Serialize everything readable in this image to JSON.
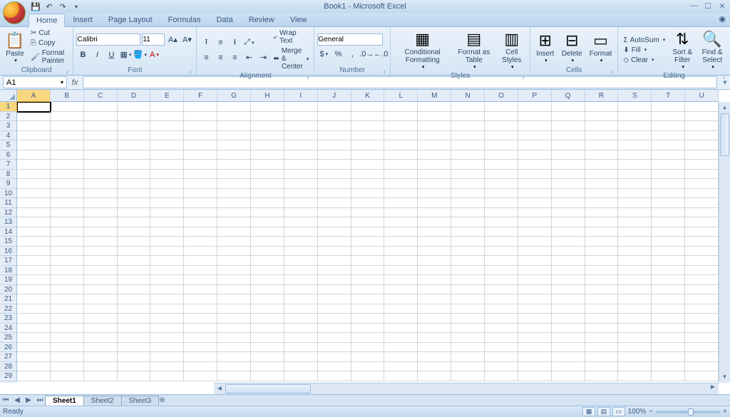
{
  "title": "Book1 - Microsoft Excel",
  "tabs": [
    "Home",
    "Insert",
    "Page Layout",
    "Formulas",
    "Data",
    "Review",
    "View"
  ],
  "active_tab": 0,
  "clipboard": {
    "label": "Clipboard",
    "paste": "Paste",
    "cut": "Cut",
    "copy": "Copy",
    "fmtpainter": "Format Painter"
  },
  "font": {
    "label": "Font",
    "name": "Calibri",
    "size": "11"
  },
  "alignment": {
    "label": "Alignment",
    "wrap": "Wrap Text",
    "merge": "Merge & Center"
  },
  "number": {
    "label": "Number",
    "format": "General"
  },
  "styles": {
    "label": "Styles",
    "cond": "Conditional\nFormatting",
    "fmt_table": "Format\nas Table",
    "cell": "Cell\nStyles"
  },
  "cells": {
    "label": "Cells",
    "insert": "Insert",
    "delete": "Delete",
    "format": "Format"
  },
  "editing": {
    "label": "Editing",
    "autosum": "AutoSum",
    "fill": "Fill",
    "clear": "Clear",
    "sort": "Sort &\nFilter",
    "find": "Find &\nSelect"
  },
  "namebox": "A1",
  "columns": [
    "A",
    "B",
    "C",
    "D",
    "E",
    "F",
    "G",
    "H",
    "I",
    "J",
    "K",
    "L",
    "M",
    "N",
    "O",
    "P",
    "Q",
    "R",
    "S",
    "T",
    "U"
  ],
  "rows": 29,
  "sheets": [
    "Sheet1",
    "Sheet2",
    "Sheet3"
  ],
  "active_sheet": 0,
  "status": "Ready",
  "zoom": "100%"
}
